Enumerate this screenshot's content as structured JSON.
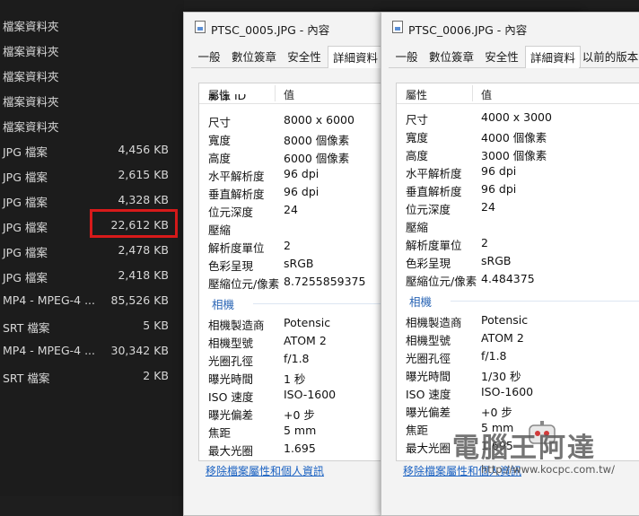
{
  "file_list": [
    {
      "type": "檔案資料夾",
      "size": ""
    },
    {
      "type": "檔案資料夾",
      "size": ""
    },
    {
      "type": "檔案資料夾",
      "size": ""
    },
    {
      "type": "檔案資料夾",
      "size": ""
    },
    {
      "type": "檔案資料夾",
      "size": ""
    },
    {
      "type": "JPG 檔案",
      "size": "4,456 KB"
    },
    {
      "type": "JPG 檔案",
      "size": "2,615 KB"
    },
    {
      "type": "JPG 檔案",
      "size": "4,328 KB"
    },
    {
      "type": "JPG 檔案",
      "size": "22,612 KB"
    },
    {
      "type": "JPG 檔案",
      "size": "2,478 KB"
    },
    {
      "type": "JPG 檔案",
      "size": "2,418 KB"
    },
    {
      "type": "MP4 - MPEG-4 ...",
      "size": "85,526 KB"
    },
    {
      "type": "SRT 檔案",
      "size": "5 KB"
    },
    {
      "type": "MP4 - MPEG-4 ...",
      "size": "30,342 KB"
    },
    {
      "type": "SRT 檔案",
      "size": "2 KB"
    }
  ],
  "highlight_color": "#d71a1a",
  "dialog1": {
    "title": "PTSC_0005.JPG - 內容",
    "tabs": [
      "一般",
      "數位簽章",
      "安全性",
      "詳細資料"
    ],
    "active_tab": 3,
    "col_property": "屬性",
    "col_value": "值",
    "partial_row": "影像 ID",
    "rows_image": [
      {
        "name": "尺寸",
        "value": "8000 x 6000"
      },
      {
        "name": "寬度",
        "value": "8000 個像素"
      },
      {
        "name": "高度",
        "value": "6000 個像素"
      },
      {
        "name": "水平解析度",
        "value": "96 dpi"
      },
      {
        "name": "垂直解析度",
        "value": "96 dpi"
      },
      {
        "name": "位元深度",
        "value": "24"
      },
      {
        "name": "壓縮",
        "value": ""
      },
      {
        "name": "解析度單位",
        "value": "2"
      },
      {
        "name": "色彩呈現",
        "value": "sRGB"
      },
      {
        "name": "壓縮位元/像素",
        "value": "8.7255859375"
      }
    ],
    "section_camera": "相機",
    "rows_camera": [
      {
        "name": "相機製造商",
        "value": "Potensic"
      },
      {
        "name": "相機型號",
        "value": "ATOM 2"
      },
      {
        "name": "光圈孔徑",
        "value": "f/1.8"
      },
      {
        "name": "曝光時間",
        "value": "1 秒"
      },
      {
        "name": "ISO 速度",
        "value": "ISO-1600"
      },
      {
        "name": "曝光偏差",
        "value": "+0 步"
      },
      {
        "name": "焦距",
        "value": "5 mm"
      },
      {
        "name": "最大光圈",
        "value": "1.695"
      }
    ],
    "footer_link": "移除檔案屬性和個人資訊"
  },
  "dialog2": {
    "title": "PTSC_0006.JPG - 內容",
    "tabs": [
      "一般",
      "數位簽章",
      "安全性",
      "詳細資料",
      "以前的版本"
    ],
    "active_tab": 3,
    "col_property": "屬性",
    "col_value": "值",
    "rows_image": [
      {
        "name": "尺寸",
        "value": "4000 x 3000"
      },
      {
        "name": "寬度",
        "value": "4000 個像素"
      },
      {
        "name": "高度",
        "value": "3000 個像素"
      },
      {
        "name": "水平解析度",
        "value": "96 dpi"
      },
      {
        "name": "垂直解析度",
        "value": "96 dpi"
      },
      {
        "name": "位元深度",
        "value": "24"
      },
      {
        "name": "壓縮",
        "value": ""
      },
      {
        "name": "解析度單位",
        "value": "2"
      },
      {
        "name": "色彩呈現",
        "value": "sRGB"
      },
      {
        "name": "壓縮位元/像素",
        "value": "4.484375"
      }
    ],
    "section_camera": "相機",
    "rows_camera": [
      {
        "name": "相機製造商",
        "value": "Potensic"
      },
      {
        "name": "相機型號",
        "value": "ATOM 2"
      },
      {
        "name": "光圈孔徑",
        "value": "f/1.8"
      },
      {
        "name": "曝光時間",
        "value": "1/30 秒"
      },
      {
        "name": "ISO 速度",
        "value": "ISO-1600"
      },
      {
        "name": "曝光偏差",
        "value": "+0 步"
      },
      {
        "name": "焦距",
        "value": "5 mm"
      },
      {
        "name": "最大光圈",
        "value": "1.695"
      }
    ],
    "footer_link": "移除檔案屬性和個人資訊"
  },
  "watermark": {
    "text": "電腦王阿達",
    "url": "http://www.kocpc.com.tw/"
  }
}
